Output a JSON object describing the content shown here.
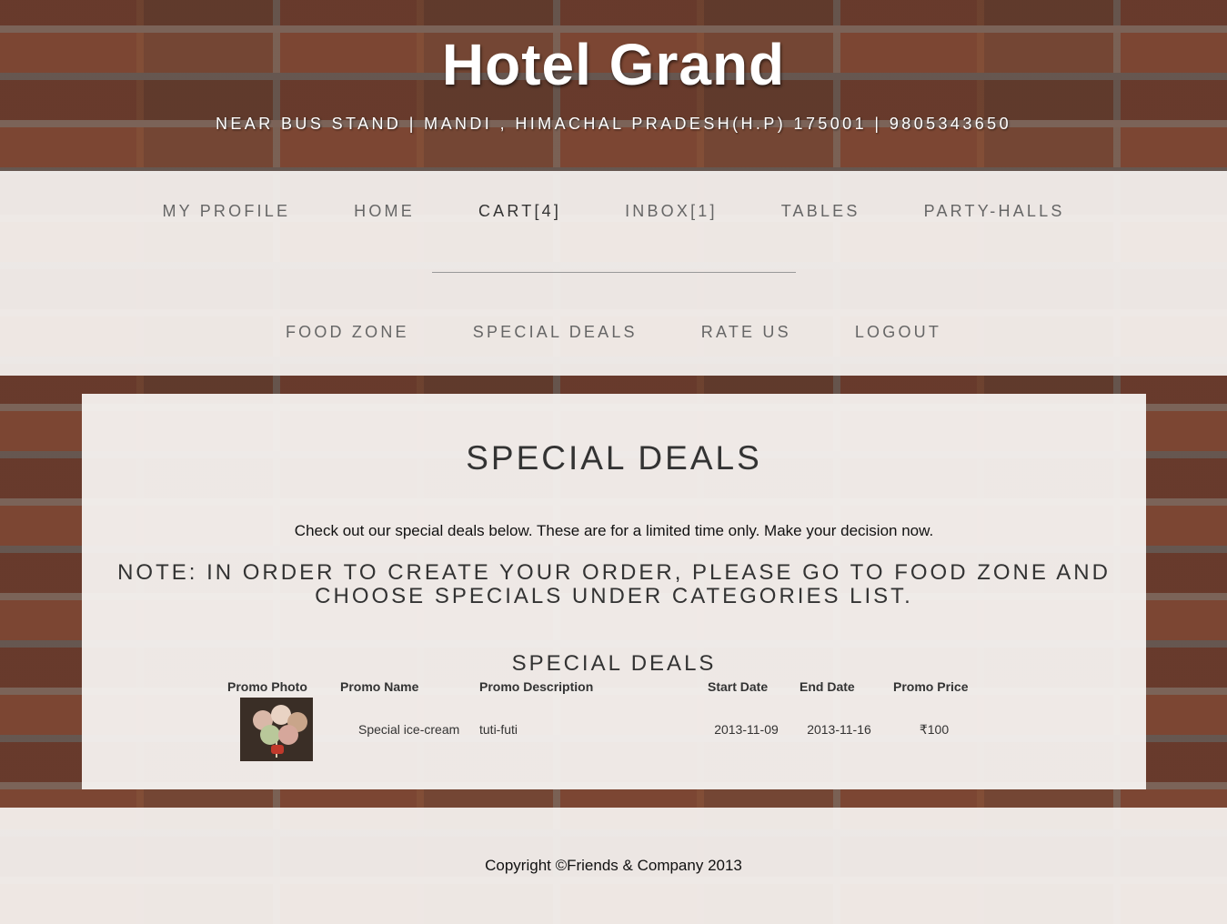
{
  "header": {
    "title": "Hotel Grand",
    "address": "NEAR BUS STAND | MANDI , HIMACHAL PRADESH(H.P) 175001 | 9805343650"
  },
  "nav": {
    "row1": [
      "MY PROFILE",
      "HOME",
      "CART[4]",
      "INBOX[1]",
      "TABLES",
      "PARTY-HALLS"
    ],
    "row2": [
      "FOOD ZONE",
      "SPECIAL DEALS",
      "RATE US",
      "LOGOUT"
    ],
    "active": "CART[4]"
  },
  "main": {
    "heading": "SPECIAL DEALS",
    "intro": "Check out our special deals below. These are for a limited time only. Make your decision now.",
    "note": "NOTE: IN ORDER TO CREATE YOUR ORDER, PLEASE GO TO FOOD ZONE AND CHOOSE SPECIALS UNDER CATEGORIES LIST.",
    "table_heading": "SPECIAL DEALS",
    "table": {
      "headers": [
        "Promo Photo",
        "Promo Name",
        "Promo Description",
        "Start Date",
        "End Date",
        "Promo Price"
      ],
      "rows": [
        {
          "photo": "ice-cream-photo",
          "name": "Special ice-cream",
          "description": "tuti-futi",
          "start": "2013-11-09",
          "end": "2013-11-16",
          "price": "₹100"
        }
      ]
    }
  },
  "footer": {
    "copyright": "Copyright ©Friends & Company 2013"
  },
  "colors": {
    "panel": "#f6f3f1",
    "text": "#333333",
    "nav_text": "#666666",
    "brick": "#8e4a34"
  }
}
